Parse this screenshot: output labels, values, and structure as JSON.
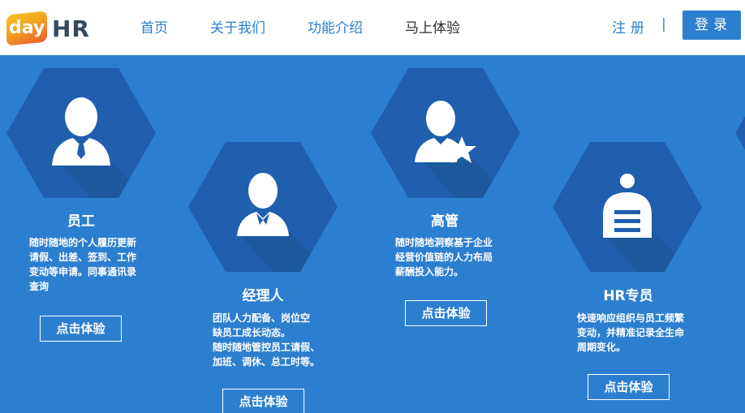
{
  "header": {
    "logo": {
      "badge": "day",
      "text": "HR"
    },
    "nav": [
      {
        "label": "首页"
      },
      {
        "label": "关于我们"
      },
      {
        "label": "功能介绍"
      },
      {
        "label": "马上体验"
      }
    ],
    "register": "注册",
    "divider": "|",
    "login": "登录"
  },
  "cards": [
    {
      "title": "员工",
      "icon": "employee-icon",
      "desc": [
        "随时随地的个人履历更新",
        "请假、出差、签到、工作",
        "变动等申请。同事通讯录",
        "查询"
      ],
      "button": "点击体验"
    },
    {
      "title": "经理人",
      "icon": "manager-icon",
      "desc": [
        "团队人力配备、岗位空",
        "缺员工成长动态。",
        "随时随地管控员工请假、",
        "加班、调休、总工时等。"
      ],
      "button": "点击体验"
    },
    {
      "title": "高管",
      "icon": "executive-star-icon",
      "desc": [
        "随时随地洞察基于企业",
        "经营价值链的人力布局",
        "薪酬投入能力。"
      ],
      "button": "点击体验"
    },
    {
      "title": "HR专员",
      "icon": "hr-specialist-icon",
      "desc": [
        "快速响应组织与员工频繁",
        "变动，并精准记录全生命",
        "周期变化。"
      ],
      "button": "点击体验"
    }
  ],
  "colors": {
    "background": "#2c7fcf",
    "hexagon": "#1f5fae",
    "accent": "#2c7fcf"
  }
}
